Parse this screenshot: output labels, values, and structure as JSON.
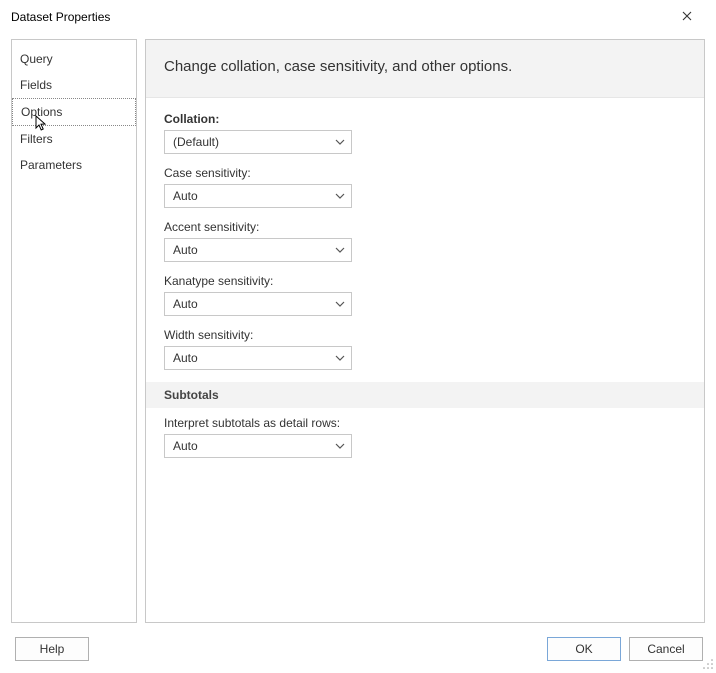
{
  "window": {
    "title": "Dataset Properties"
  },
  "sidebar": {
    "items": [
      {
        "label": "Query"
      },
      {
        "label": "Fields"
      },
      {
        "label": "Options"
      },
      {
        "label": "Filters"
      },
      {
        "label": "Parameters"
      }
    ],
    "selected_index": 2
  },
  "header": {
    "description": "Change collation, case sensitivity, and other options."
  },
  "options": {
    "collation_label": "Collation:",
    "collation_value": "(Default)",
    "case_label": "Case sensitivity:",
    "case_value": "Auto",
    "accent_label": "Accent sensitivity:",
    "accent_value": "Auto",
    "kanatype_label": "Kanatype sensitivity:",
    "kanatype_value": "Auto",
    "width_label": "Width sensitivity:",
    "width_value": "Auto"
  },
  "subtotals": {
    "section_title": "Subtotals",
    "interpret_label": "Interpret subtotals as detail rows:",
    "interpret_value": "Auto"
  },
  "buttons": {
    "help": "Help",
    "ok": "OK",
    "cancel": "Cancel"
  }
}
